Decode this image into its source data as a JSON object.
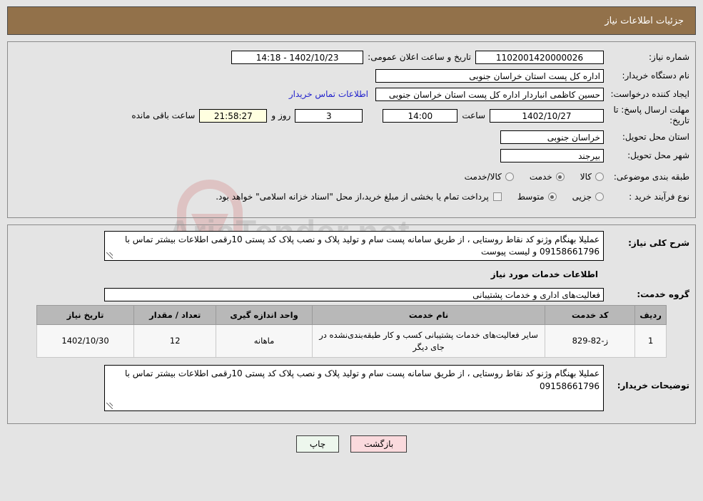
{
  "header": {
    "title": "جزئیات اطلاعات نیاز",
    "bar_color": "#92714a"
  },
  "watermark": {
    "text": "AriaTender.net"
  },
  "fields": {
    "need_number_label": "شماره نیاز:",
    "need_number_value": "1102001420000026",
    "public_announce_label": "تاریخ و ساعت اعلان عمومی:",
    "public_announce_value": "1402/10/23 - 14:18",
    "buyer_org_label": "نام دستگاه خریدار:",
    "buyer_org_value": "اداره کل پست استان خراسان جنوبی",
    "creator_label": "ایجاد کننده درخواست:",
    "creator_value": "حسین کاظمی انباردار اداره کل پست استان خراسان جنوبی",
    "contact_link": "اطلاعات تماس خریدار",
    "deadline_label": "مهلت ارسال پاسخ: تا تاریخ:",
    "deadline_date": "1402/10/27",
    "hour_label": "ساعت",
    "deadline_hour": "14:00",
    "days_value": "3",
    "days_label": "روز و",
    "remaining_time": "21:58:27",
    "remaining_label": "ساعت باقی مانده",
    "province_label": "استان محل تحویل:",
    "province_value": "خراسان جنوبی",
    "city_label": "شهر محل تحویل:",
    "city_value": "بیرجند",
    "category_label": "طبقه بندی موضوعی:",
    "process_label": "نوع فرآیند خرید :",
    "payment_note": "پرداخت تمام یا بخشی از مبلغ خرید،از محل \"اسناد خزانه اسلامی\" خواهد بود."
  },
  "category_options": [
    {
      "label": "کالا",
      "selected": false
    },
    {
      "label": "خدمت",
      "selected": true
    },
    {
      "label": "کالا/خدمت",
      "selected": false
    }
  ],
  "process_options": [
    {
      "label": "جزیی",
      "selected": false
    },
    {
      "label": "متوسط",
      "selected": true
    }
  ],
  "payment_checkbox_checked": false,
  "description": {
    "label": "شرح کلی نیاز:",
    "value": "عملیلا بهنگام وژنو کد نقاط روستایی ، از طریق سامانه پست سام و تولید پلاک و نصب پلاک کد پستی 10رقمی اطلاعات بیشتر تماس با 09158661796 و لیست پیوست"
  },
  "services_section_title": "اطلاعات خدمات مورد نیاز",
  "service_group": {
    "label": "گروه خدمت:",
    "value": "فعالیت‌های اداری و خدمات پشتیبانی"
  },
  "table": {
    "columns": [
      "ردیف",
      "کد خدمت",
      "نام خدمت",
      "واحد اندازه گیری",
      "تعداد / مقدار",
      "تاریخ نیاز"
    ],
    "rows": [
      {
        "row": "1",
        "code": "ز-82-829",
        "name": "سایر فعالیت‌های خدمات پشتیبانی کسب و کار طبقه‌بندی‌نشده در جای دیگر",
        "unit": "ماهانه",
        "qty": "12",
        "date": "1402/10/30"
      }
    ]
  },
  "buyer_notes": {
    "label": "توضیحات خریدار:",
    "value": "عملیلا بهنگام وژنو کد نقاط روستایی ، از طریق سامانه پست سام و تولید پلاک و نصب پلاک کد پستی 10رقمی اطلاعات بیشتر تماس با 09158661796"
  },
  "buttons": {
    "print": "چاپ",
    "back": "بازگشت"
  }
}
